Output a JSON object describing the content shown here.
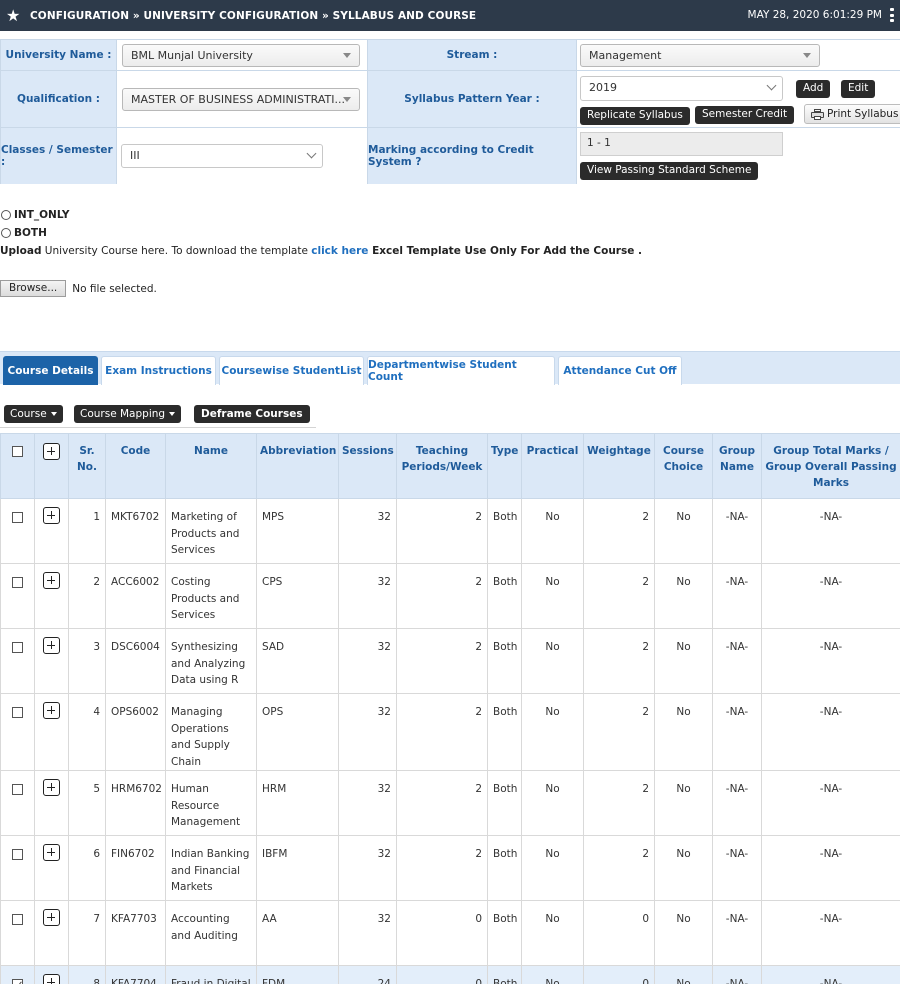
{
  "topbar": {
    "breadcrumb": "CONFIGURATION » UNIVERSITY CONFIGURATION » SYLLABUS AND COURSE",
    "datetime": "MAY 28, 2020  6:01:29 PM"
  },
  "config": {
    "university_label": "University Name :",
    "university_value": "BML Munjal University",
    "stream_label": "Stream :",
    "stream_value": "Management",
    "qualification_label": "Qualification :",
    "qualification_value": "MASTER OF BUSINESS ADMINISTRATI...",
    "syllabus_year_label": "Syllabus Pattern Year :",
    "syllabus_year_value": "2019",
    "add_label": "Add",
    "edit_label": "Edit",
    "replicate_label": "Replicate Syllabus",
    "semester_credit_label": "Semester Credit",
    "print_label": "Print Syllabus",
    "classes_label": "Classes / Semester :",
    "classes_value": "III",
    "marking_label": "Marking according to Credit System ?",
    "marking_value": "1 - 1",
    "view_passing_label": "View Passing Standard Scheme"
  },
  "options": {
    "int_only": "INT_ONLY",
    "both": "BOTH"
  },
  "upload": {
    "upload_bold": "Upload",
    "text1": " University Course here. To download the template  ",
    "link": "click here",
    "text2": " Excel Template Use Only For Add the Course .",
    "browse_label": "Browse...",
    "file_status": "No file selected."
  },
  "tabs": [
    {
      "label": "Course Details"
    },
    {
      "label": "Exam Instructions"
    },
    {
      "label": "Coursewise StudentList"
    },
    {
      "label": "Departmentwise Student Count"
    },
    {
      "label": "Attendance Cut Off"
    }
  ],
  "toolbar": {
    "course_label": "Course",
    "mapping_label": "Course Mapping",
    "deframe_label": "Deframe Courses"
  },
  "table": {
    "headers": {
      "sr": "Sr. No.",
      "code": "Code",
      "name": "Name",
      "abbr": "Abbreviation",
      "sessions": "Sessions",
      "teaching": "Teaching Periods/Week",
      "type": "Type",
      "practical": "Practical",
      "weightage": "Weightage",
      "choice": "Course Choice",
      "group": "Group Name",
      "group_total": "Group Total Marks / Group Overall Passing Marks"
    },
    "rows": [
      {
        "sr": "1",
        "code": "MKT6702",
        "name": "Marketing of Products and Services",
        "abbr": "MPS",
        "sessions": "32",
        "teaching": "2",
        "type": "Both",
        "practical": "No",
        "weightage": "2",
        "choice": "No",
        "group": "-NA-",
        "group_total": "-NA-",
        "checked": false
      },
      {
        "sr": "2",
        "code": "ACC6002",
        "name": "Costing Products and Services",
        "abbr": "CPS",
        "sessions": "32",
        "teaching": "2",
        "type": "Both",
        "practical": "No",
        "weightage": "2",
        "choice": "No",
        "group": "-NA-",
        "group_total": "-NA-",
        "checked": false
      },
      {
        "sr": "3",
        "code": "DSC6004",
        "name": "Synthesizing and Analyzing Data using R",
        "abbr": "SAD",
        "sessions": "32",
        "teaching": "2",
        "type": "Both",
        "practical": "No",
        "weightage": "2",
        "choice": "No",
        "group": "-NA-",
        "group_total": "-NA-",
        "checked": false
      },
      {
        "sr": "4",
        "code": "OPS6002",
        "name": "Managing Operations and Supply Chain",
        "abbr": "OPS",
        "sessions": "32",
        "teaching": "2",
        "type": "Both",
        "practical": "No",
        "weightage": "2",
        "choice": "No",
        "group": "-NA-",
        "group_total": "-NA-",
        "checked": false
      },
      {
        "sr": "5",
        "code": "HRM6702",
        "name": "Human Resource Management",
        "abbr": "HRM",
        "sessions": "32",
        "teaching": "2",
        "type": "Both",
        "practical": "No",
        "weightage": "2",
        "choice": "No",
        "group": "-NA-",
        "group_total": "-NA-",
        "checked": false
      },
      {
        "sr": "6",
        "code": "FIN6702",
        "name": "Indian Banking and Financial Markets",
        "abbr": "IBFM",
        "sessions": "32",
        "teaching": "2",
        "type": "Both",
        "practical": "No",
        "weightage": "2",
        "choice": "No",
        "group": "-NA-",
        "group_total": "-NA-",
        "checked": false
      },
      {
        "sr": "7",
        "code": "KFA7703",
        "name": "Accounting and Auditing",
        "abbr": "AA",
        "sessions": "32",
        "teaching": "0",
        "type": "Both",
        "practical": "No",
        "weightage": "0",
        "choice": "No",
        "group": "-NA-",
        "group_total": "-NA-",
        "checked": false
      },
      {
        "sr": "8",
        "code": "KFA7704",
        "name": "Fraud in Digital Environment",
        "abbr": "FDM",
        "sessions": "24",
        "teaching": "0",
        "type": "Both",
        "practical": "No",
        "weightage": "0",
        "choice": "No",
        "group": "-NA-",
        "group_total": "-NA-",
        "checked": true
      }
    ]
  }
}
